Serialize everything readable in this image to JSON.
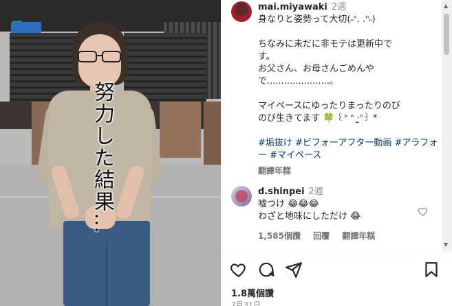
{
  "post": {
    "owner": "mai.miyawaki",
    "time": "2週",
    "caption_lines": [
      "身なりと姿勢って大切(˶ᐢ. .ᐢ˶)",
      "",
      "ちなみに未だに非モテは更新中で",
      "す。",
      "お父さん、お母さんごめんや",
      "で......................。",
      "",
      "マイペースにゆったりまったりのび",
      "のび生きてます 🍀 ꒰ᐡ ᐢ ·̫ᐢ꒱ *",
      ""
    ],
    "hashtags": "#垢抜け #ビフォーアフター動画 #アラフォー #マイペース",
    "translate_label": "翻譯年糕"
  },
  "media": {
    "overlay_text": "努力した結果…"
  },
  "comment": {
    "username": "d.shinpei",
    "time": "2週",
    "line1": "嘘つけ 😂😂😂",
    "line2": "わざと地味にしただけ 😂",
    "likes": "1,585個讚",
    "reply": "回覆",
    "translate": "翻譯年糕"
  },
  "footer": {
    "likes": "1.8萬個讚",
    "date": "7月31日"
  },
  "icons": {
    "like": "heart-icon",
    "comment": "comment-icon",
    "share": "paper-plane-icon",
    "save": "bookmark-icon"
  }
}
